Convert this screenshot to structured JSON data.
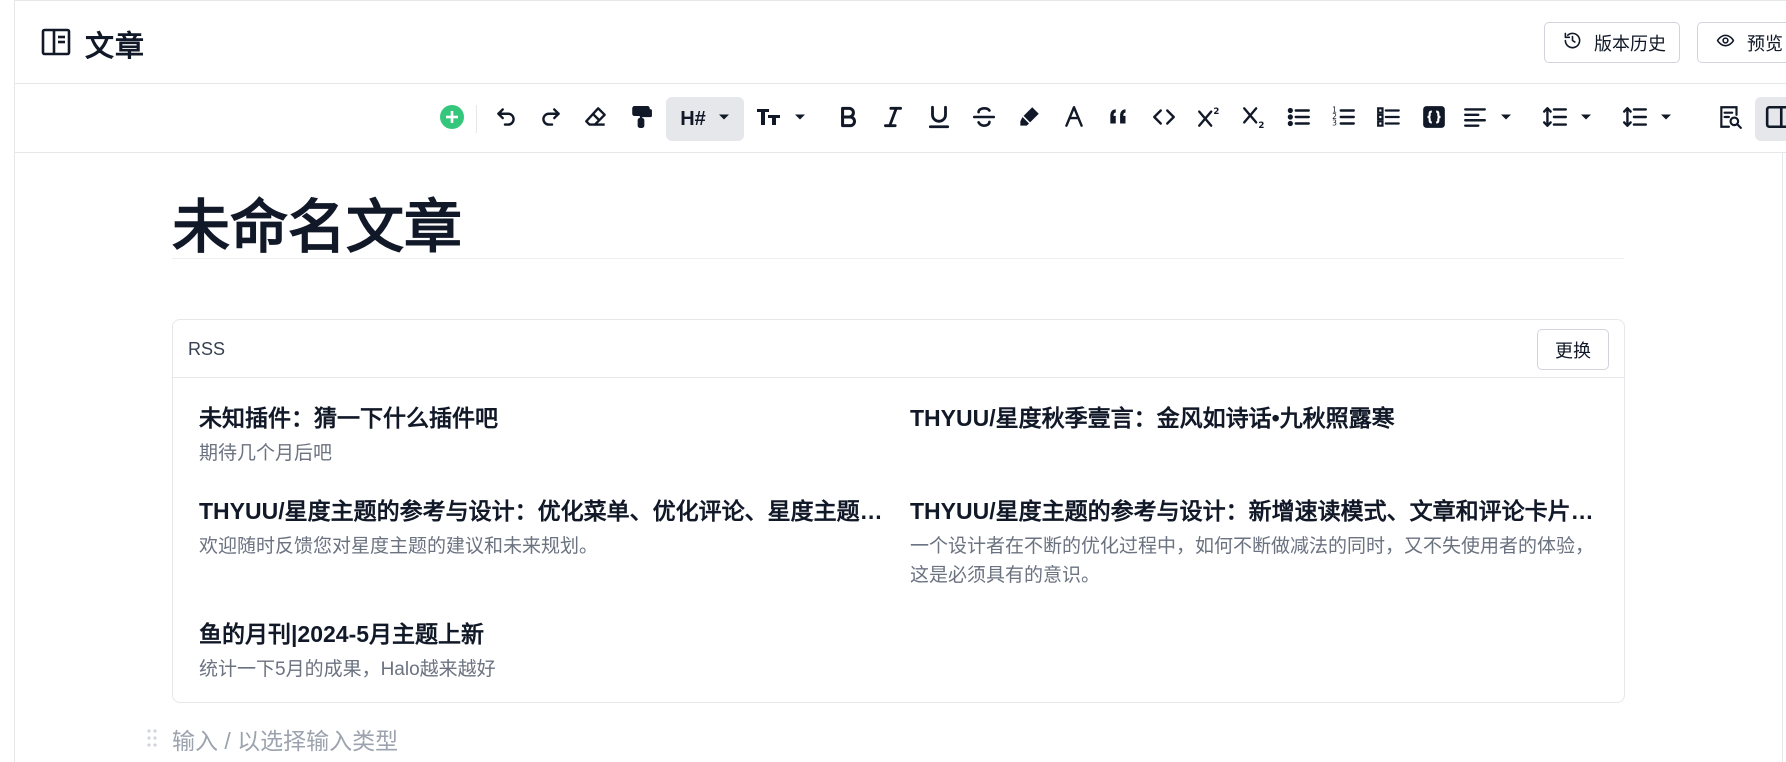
{
  "header": {
    "title": "文章",
    "history_button": "版本历史",
    "preview_button": "预览"
  },
  "toolbar": {
    "heading_label": "H#",
    "buttons": [
      "add-block",
      "undo",
      "redo",
      "clear-format",
      "format-painter",
      "heading",
      "font-size",
      "bold",
      "italic",
      "underline",
      "strikethrough",
      "highlight",
      "font-color",
      "blockquote",
      "code",
      "superscript",
      "subscript",
      "bullet-list",
      "ordered-list",
      "task-list",
      "code-block",
      "align",
      "line-height",
      "paragraph-spacing",
      "search-replace",
      "toggle-sidebar"
    ]
  },
  "document": {
    "title": "未命名文章",
    "placeholder": "输入 / 以选择输入类型"
  },
  "rss": {
    "label": "RSS",
    "replace_button": "更换",
    "items": [
      {
        "title": "未知插件：猜一下什么插件吧",
        "desc": "期待几个月后吧"
      },
      {
        "title": "THYUU/星度秋季壹言：金风如诗话•九秋照露寒",
        "desc": ""
      },
      {
        "title": "THYUU/星度主题的参考与设计：优化菜单、优化评论、星度主题正式开源",
        "desc": "欢迎随时反馈您对星度主题的建议和未来规划。"
      },
      {
        "title": "THYUU/星度主题的参考与设计：新增速读模式、文章和评论卡片重构",
        "desc": "一个设计者在不断的优化过程中，如何不断做减法的同时，又不失使用者的体验，这是必须具有的意识。"
      },
      {
        "title": "鱼的月刊|2024-5月主题上新",
        "desc": "统计一下5月的成果，Halo越来越好"
      }
    ]
  }
}
